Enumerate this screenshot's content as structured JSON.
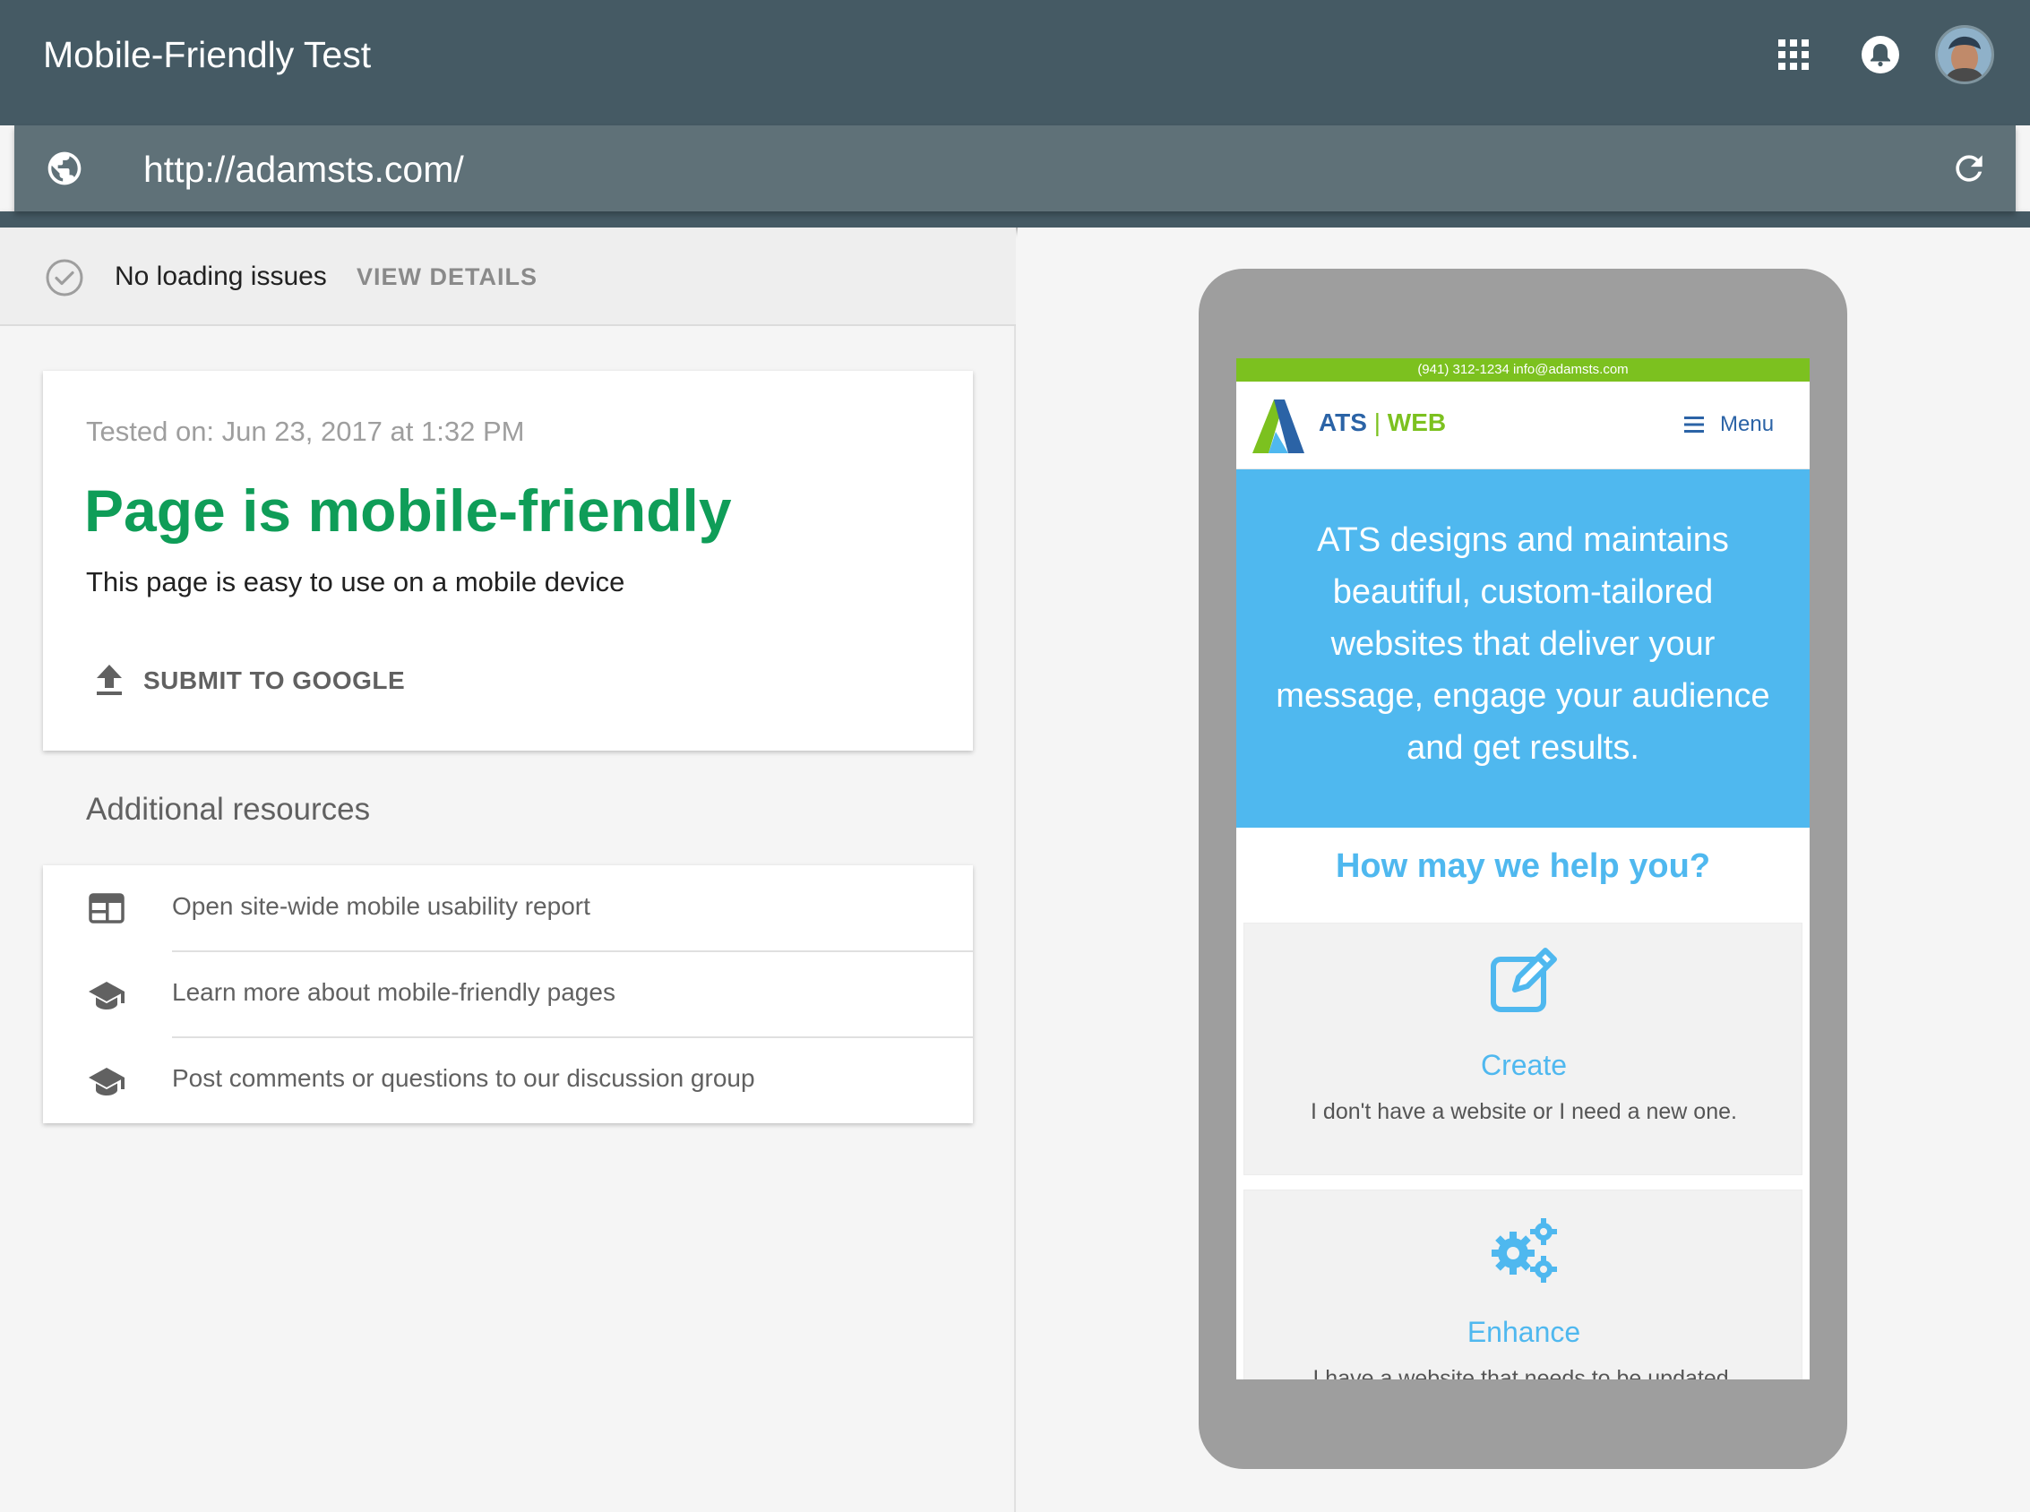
{
  "header": {
    "title": "Mobile-Friendly Test",
    "icons": [
      "apps-icon",
      "notifications-icon",
      "avatar"
    ]
  },
  "urlbar": {
    "url": "http://adamsts.com/",
    "icons": [
      "globe-icon",
      "reload-icon"
    ]
  },
  "status": {
    "text": "No loading issues",
    "action": "VIEW DETAILS",
    "icon": "check-circle-icon"
  },
  "result": {
    "tested_on": "Tested on: Jun 23, 2017 at 1:32 PM",
    "title": "Page is mobile-friendly",
    "subtitle": "This page is easy to use on a mobile device",
    "submit_label": "SUBMIT TO GOOGLE",
    "title_color": "#0f9d58"
  },
  "resources": {
    "title": "Additional resources",
    "items": [
      {
        "label": "Open site-wide mobile usability report",
        "icon": "web-layout-icon"
      },
      {
        "label": "Learn more about mobile-friendly pages",
        "icon": "school-icon"
      },
      {
        "label": "Post comments or questions to our discussion group",
        "icon": "school-icon"
      }
    ]
  },
  "preview": {
    "topline": "(941) 312-1234   info@adamsts.com",
    "logo_ats": "ATS",
    "logo_sep": "|",
    "logo_web": "WEB",
    "menu_label": "Menu",
    "hero_text": "ATS designs and maintains beautiful, custom-tailored websites that deliver your message, engage your audience and get results.",
    "help_title": "How may we help you?",
    "services": [
      {
        "title": "Create",
        "desc": "I don't have a website or I need a new one.",
        "icon": "edit-icon"
      },
      {
        "title": "Enhance",
        "desc": "I have a website that needs to be updated.",
        "icon": "gears-icon"
      }
    ],
    "colors": {
      "accent_blue": "#4fb8ef",
      "brand_green": "#7cc11f",
      "brand_navy": "#2b63a6"
    }
  }
}
